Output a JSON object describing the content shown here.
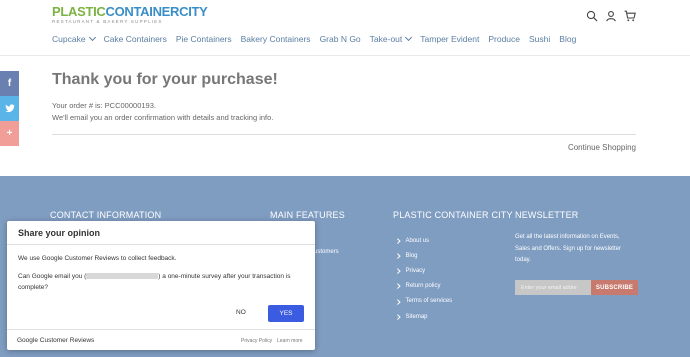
{
  "logo": {
    "part1": "PLASTIC",
    "part2": "CONTAINERCITY",
    "tagline": "RESTAURANT & BAKERY SUPPLIES"
  },
  "header_icons": [
    "search-icon",
    "user-icon",
    "cart-icon"
  ],
  "nav": [
    {
      "label": "Cupcake",
      "has_dropdown": true
    },
    {
      "label": "Cake Containers"
    },
    {
      "label": "Pie Containers"
    },
    {
      "label": "Bakery Containers"
    },
    {
      "label": "Grab N Go"
    },
    {
      "label": "Take-out",
      "has_dropdown": true
    },
    {
      "label": "Tamper Evident"
    },
    {
      "label": "Produce"
    },
    {
      "label": "Sushi"
    },
    {
      "label": "Blog"
    }
  ],
  "social": {
    "facebook": "f",
    "plus": "+"
  },
  "main": {
    "title": "Thank you for your purchase!",
    "order_text": "Your order # is: PCC00000193.",
    "email_text": "We'll email you an order confirmation with details and tracking info.",
    "continue_label": "Continue Shopping"
  },
  "footer": {
    "contact_heading": "CONTACT INFORMATION",
    "features_heading": "MAIN FEATURES",
    "features_partial": "ustomers",
    "pcc_heading": "PLASTIC CONTAINER CITY",
    "links": [
      "About us",
      "Blog",
      "Privacy",
      "Return policy",
      "Terms of services",
      "Sitemap"
    ],
    "newsletter_heading": "NEWSLETTER",
    "newsletter_text": "Get all the latest information on Events, Sales and Offers. Sign up for newsletter today.",
    "newsletter_placeholder": "Enter your email addre",
    "subscribe_label": "SUBSCRIBE"
  },
  "dialog": {
    "title": "Share your opinion",
    "text1": "We use Google Customer Reviews to collect feedback.",
    "text2_before": "Can Google email you (",
    "text2_after": ") a one-minute survey after your transaction is complete?",
    "no_label": "NO",
    "yes_label": "YES",
    "brand": "Google Customer Reviews",
    "policy": "Privacy Policy",
    "learn_more": "Learn more"
  },
  "colors": {
    "footer_bg": "#7f9cc1",
    "yes_button": "#3b5ce0",
    "subscribe_button": "#c87a6e",
    "nav_text": "#5b7ea3"
  }
}
